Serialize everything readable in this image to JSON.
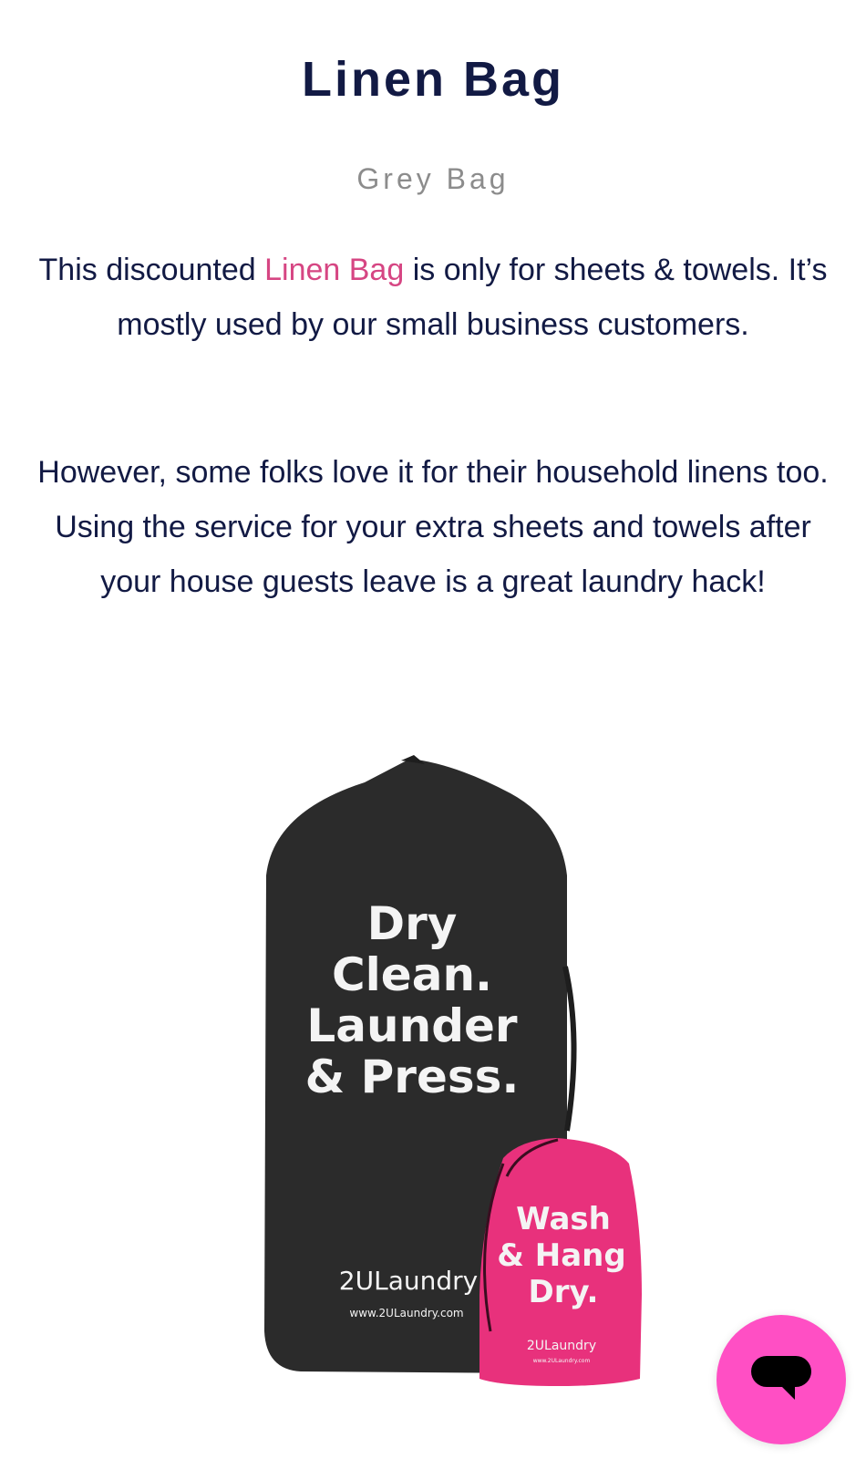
{
  "title": "Linen Bag",
  "subtitle": "Grey Bag",
  "paragraph1": {
    "before": "This discounted ",
    "link": "Linen Bag",
    "after": " is only for sheets & towels.  It’s mostly used by our small business customers."
  },
  "paragraph2": "However, some folks love it for their household linens too. Using the service for your extra sheets and towels after your house guests leave is a great laundry hack!",
  "product_image": {
    "black_bag": {
      "line1": "Dry",
      "line2": "Clean.",
      "line3": "Launder",
      "line4": "& Press.",
      "brand": "2ULaundry",
      "url": "www.2ULaundry.com"
    },
    "pink_bag": {
      "line1": "Wash",
      "line2": "& Hang",
      "line3": "Dry.",
      "brand": "2ULaundry",
      "url": "www.2ULaundry.com"
    }
  },
  "colors": {
    "text": "#121a44",
    "link": "#d64683",
    "subtitle": "#8c8c8c",
    "chat": "#ff4fc4",
    "black_bag": "#2b2b2b",
    "pink_bag": "#e8317c"
  },
  "chat": {
    "icon": "chat-bubble-icon"
  }
}
